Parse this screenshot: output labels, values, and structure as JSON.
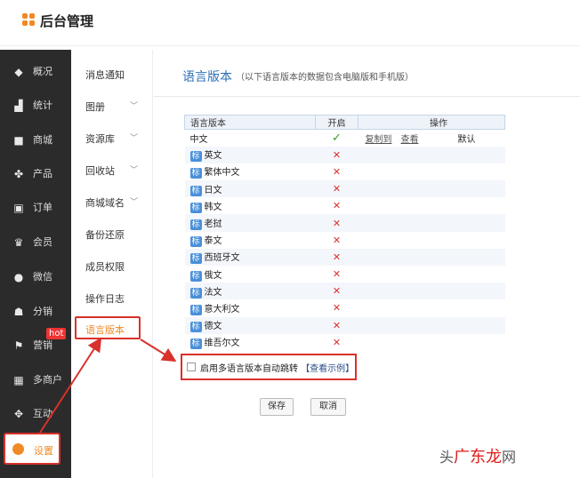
{
  "app": {
    "title": "后台管理"
  },
  "sidebar": {
    "items": [
      {
        "label": "概况",
        "icon": "layers-icon"
      },
      {
        "label": "统计",
        "icon": "chart-icon"
      },
      {
        "label": "商城",
        "icon": "shop-icon"
      },
      {
        "label": "产品",
        "icon": "grid-icon"
      },
      {
        "label": "订单",
        "icon": "order-icon"
      },
      {
        "label": "会员",
        "icon": "crown-icon"
      },
      {
        "label": "微信",
        "icon": "wechat-icon"
      },
      {
        "label": "分销",
        "icon": "users-icon"
      },
      {
        "label": "营销",
        "icon": "flag-icon"
      },
      {
        "label": "多商户",
        "icon": "store-icon"
      },
      {
        "label": "互动",
        "icon": "interact-icon"
      }
    ],
    "hot_badge": "hot",
    "settings_label": "设置"
  },
  "submenu": {
    "items": [
      {
        "label": "消息通知"
      },
      {
        "label": "图册"
      },
      {
        "label": "资源库"
      },
      {
        "label": "回收站"
      },
      {
        "label": "商城域名"
      },
      {
        "label": "备份还原"
      },
      {
        "label": "成员权限"
      },
      {
        "label": "操作日志"
      }
    ],
    "active": "语言版本"
  },
  "main": {
    "title": "语言版本",
    "subtitle": "（以下语言版本的数据包含电脑版和手机版）",
    "table": {
      "headers": [
        "语言版本",
        "开启",
        "操作"
      ],
      "rows": [
        {
          "name": "中文",
          "tagged": false,
          "enabled": true,
          "ops": [
            "复制到",
            "查看"
          ],
          "default": "默认"
        },
        {
          "name": "英文",
          "tagged": true,
          "enabled": false
        },
        {
          "name": "繁体中文",
          "tagged": true,
          "enabled": false
        },
        {
          "name": "日文",
          "tagged": true,
          "enabled": false
        },
        {
          "name": "韩文",
          "tagged": true,
          "enabled": false
        },
        {
          "name": "老挝",
          "tagged": true,
          "enabled": false
        },
        {
          "name": "泰文",
          "tagged": true,
          "enabled": false
        },
        {
          "name": "西班牙文",
          "tagged": true,
          "enabled": false
        },
        {
          "name": "俄文",
          "tagged": true,
          "enabled": false
        },
        {
          "name": "法文",
          "tagged": true,
          "enabled": false
        },
        {
          "name": "意大利文",
          "tagged": true,
          "enabled": false
        },
        {
          "name": "德文",
          "tagged": true,
          "enabled": false
        },
        {
          "name": "维吾尔文",
          "tagged": true,
          "enabled": false
        }
      ],
      "tag_label": "标",
      "check_glyph": "✓",
      "cross_glyph": "✕"
    },
    "auto_redirect": {
      "label": "启用多语言版本自动跳转",
      "link": "【查看示例】",
      "checked": false
    },
    "buttons": {
      "save": "保存",
      "cancel": "取消"
    }
  },
  "watermark": {
    "prefix": "头",
    "brand": "广东龙",
    "suffix": "网"
  },
  "colors": {
    "accent": "#f08a24",
    "highlight": "#d9312b",
    "title_blue": "#2d6fb5",
    "sidebar_bg": "#2b2b2b"
  }
}
